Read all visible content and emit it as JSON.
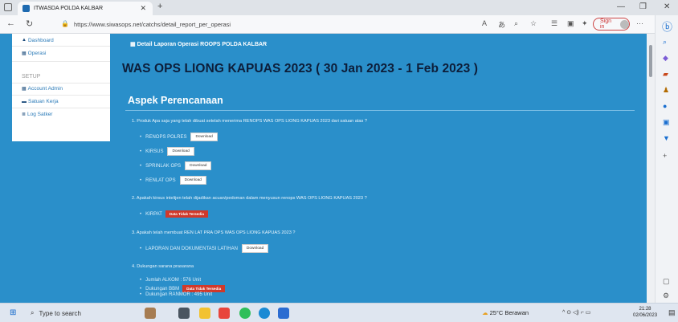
{
  "browser": {
    "tab_title": "ITWASDA POLDA KALBAR",
    "url": "https://www.siwasops.net/catchs/detail_report_per_operasi",
    "sign_in": "Sign in"
  },
  "sidebar": {
    "items_top": [
      {
        "label": "Dashboard",
        "icon": "home-icon"
      },
      {
        "label": "Operasi",
        "icon": "table-icon"
      }
    ],
    "setup_heading": "SETUP",
    "items_setup": [
      {
        "label": "Account Admin",
        "icon": "table-icon"
      },
      {
        "label": "Satuan Kerja",
        "icon": "flag-icon"
      },
      {
        "label": "Log Satker",
        "icon": "list-icon"
      }
    ]
  },
  "panel": {
    "title": "Detail Laporan Operasi ROOPS POLDA KALBAR",
    "main_title": "WAS OPS LIONG KAPUAS 2023 ( 30 Jan 2023 - 1 Feb 2023 )",
    "section": "Aspek Perencanaan"
  },
  "questions": [
    {
      "text": "1. Produk Apa saja yang telah dibuat setelah menerima RENOPS WAS OPS LIONG KAPUAS 2023 dari satuan atas ?",
      "items": [
        {
          "label": "RENOPS POLRES",
          "action": "Download"
        },
        {
          "label": "KIRSUS",
          "action": "Download"
        },
        {
          "label": "SPRINLAK OPS",
          "action": "Download"
        },
        {
          "label": "RENLAT OPS",
          "action": "Download"
        }
      ]
    },
    {
      "text": "2. Apakah kirsus intelijen telah dijadikan acuan/pedoman dalam menyusun renops WAS OPS LIONG KAPUAS 2023 ?",
      "items": [
        {
          "label": "KIRPAT",
          "status": "Data Tidak Tersedia"
        }
      ]
    },
    {
      "text": "3. Apakah telah membuat REN LAT PRA OPS WAS OPS LIONG KAPUAS 2023 ?",
      "items": [
        {
          "label": "LAPORAN DAN DOKUMENTASI LATIHAN",
          "action": "Download"
        }
      ]
    },
    {
      "text": "4. Dukungan sarana prasarana",
      "items": [
        {
          "label": "Jumlah ALKOM : 576 Unit"
        },
        {
          "label": "Dukungan BBM",
          "status": "Data Tidak Tersedia"
        },
        {
          "label": "Dukungan RANMOR : 495 Unit"
        }
      ]
    }
  ],
  "taskbar": {
    "search_placeholder": "Type to search",
    "weather": "25°C  Berawan",
    "time": "21:28",
    "date": "02/06/2023"
  }
}
